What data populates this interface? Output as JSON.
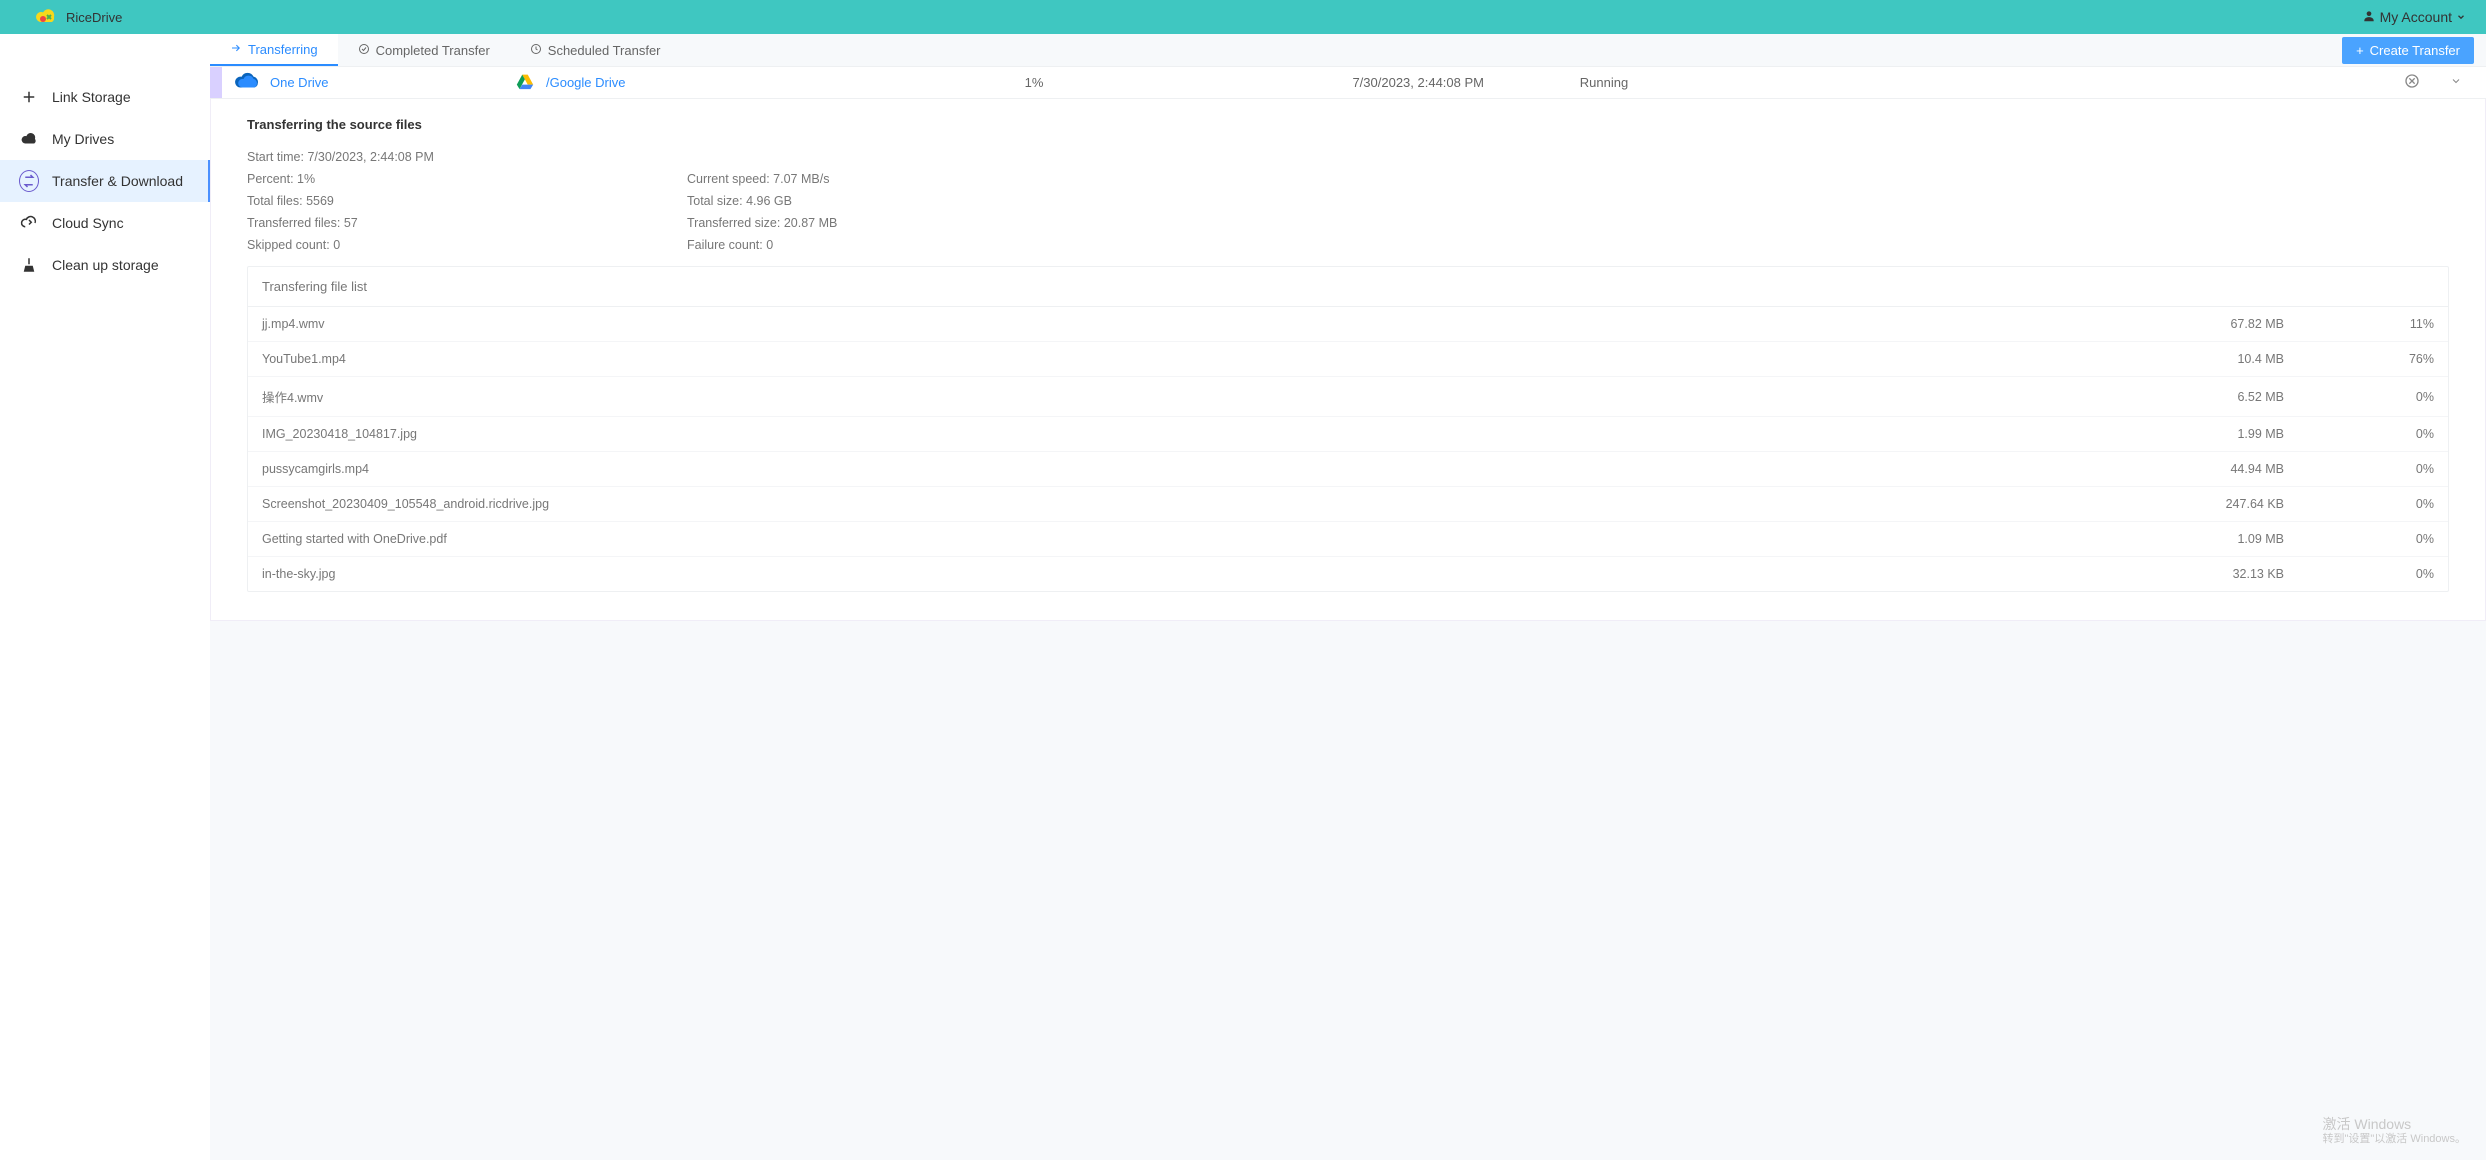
{
  "brand": {
    "name": "RiceDrive"
  },
  "account": {
    "label": "My Account"
  },
  "sidebar": {
    "items": [
      {
        "label": "Link Storage"
      },
      {
        "label": "My Drives"
      },
      {
        "label": "Transfer & Download"
      },
      {
        "label": "Cloud Sync"
      },
      {
        "label": "Clean up storage"
      }
    ],
    "activeIndex": 2
  },
  "tabs": {
    "items": [
      {
        "label": "Transferring"
      },
      {
        "label": "Completed Transfer"
      },
      {
        "label": "Scheduled Transfer"
      }
    ],
    "activeIndex": 0,
    "createLabel": "Create Transfer"
  },
  "transfer": {
    "source": {
      "name": "One Drive"
    },
    "dest": {
      "name": "/Google Drive"
    },
    "percent": "1%",
    "time": "7/30/2023, 2:44:08 PM",
    "status": "Running"
  },
  "details": {
    "header": "Transferring the source files",
    "start_time_label": "Start time:",
    "start_time": "7/30/2023, 2:44:08 PM",
    "percent_label": "Percent:",
    "percent": "1%",
    "speed_label": "Current speed:",
    "speed": "7.07 MB/s",
    "total_files_label": "Total files:",
    "total_files": "5569",
    "total_size_label": "Total size:",
    "total_size": "4.96 GB",
    "transferred_files_label": "Transferred files:",
    "transferred_files": "57",
    "transferred_size_label": "Transferred size:",
    "transferred_size": "20.87 MB",
    "skipped_label": "Skipped count:",
    "skipped": "0",
    "failure_label": "Failure count:",
    "failure": "0"
  },
  "filelist": {
    "header": "Transfering file list",
    "rows": [
      {
        "name": "jj.mp4.wmv",
        "size": "67.82 MB",
        "pct": "11%"
      },
      {
        "name": "YouTube1.mp4",
        "size": "10.4 MB",
        "pct": "76%"
      },
      {
        "name": "操作4.wmv",
        "size": "6.52 MB",
        "pct": "0%"
      },
      {
        "name": "IMG_20230418_104817.jpg",
        "size": "1.99 MB",
        "pct": "0%"
      },
      {
        "name": "pussycamgirls.mp4",
        "size": "44.94 MB",
        "pct": "0%"
      },
      {
        "name": "Screenshot_20230409_105548_android.ricdrive.jpg",
        "size": "247.64 KB",
        "pct": "0%"
      },
      {
        "name": "Getting started with OneDrive.pdf",
        "size": "1.09 MB",
        "pct": "0%"
      },
      {
        "name": "in-the-sky.jpg",
        "size": "32.13 KB",
        "pct": "0%"
      }
    ]
  },
  "watermark": {
    "title": "激活 Windows",
    "sub": "转到\"设置\"以激活 Windows。"
  }
}
